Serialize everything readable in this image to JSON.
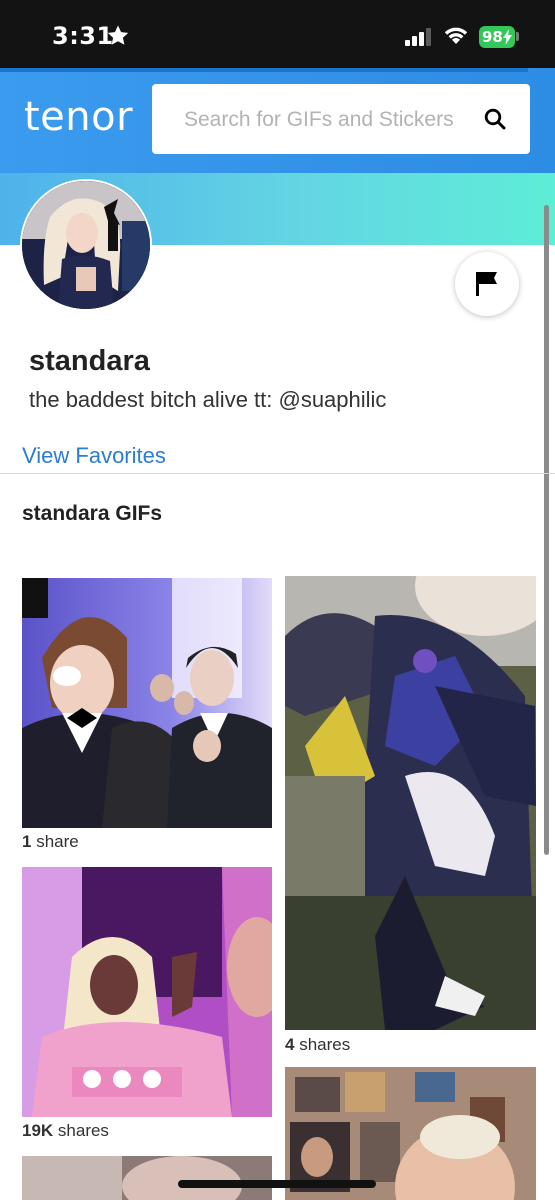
{
  "status_bar": {
    "time": "3:31",
    "battery": "98"
  },
  "header": {
    "logo": "tenor",
    "search_placeholder": "Search for GIFs and Stickers"
  },
  "profile": {
    "username": "standara",
    "bio": "the baddest bitch alive tt: @suaphilic",
    "view_favorites": "View Favorites",
    "section_title": "standara GIFs"
  },
  "gifs": [
    {
      "count": "1",
      "label": " share"
    },
    {
      "count": "4",
      "label": " shares"
    },
    {
      "count": "19K",
      "label": " shares"
    }
  ],
  "icons": [
    "star-icon",
    "signal-icon",
    "wifi-icon",
    "battery-icon",
    "search-icon",
    "flag-icon"
  ]
}
